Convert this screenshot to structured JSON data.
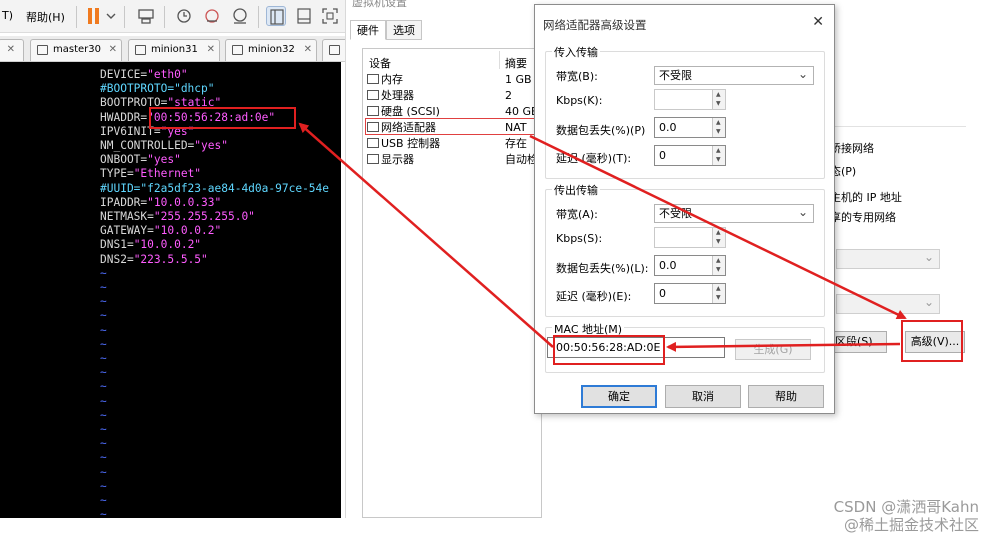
{
  "menubar": {
    "partial_item": "T)",
    "help_menu": "帮助(H)"
  },
  "tabs": [
    {
      "label": "master30"
    },
    {
      "label": "minion31"
    },
    {
      "label": "minion32"
    }
  ],
  "terminal": {
    "lines": [
      {
        "key": "DEVICE=",
        "value": "\"eth0\"",
        "comment": false
      },
      {
        "key": "#BOOTPROTO=\"dhcp\"",
        "value": "",
        "comment": true
      },
      {
        "key": "BOOTPROTO=",
        "value": "\"static\"",
        "comment": false
      },
      {
        "key": "HWADDR=",
        "value": "\"00:50:56:28:ad:0e\"",
        "comment": false
      },
      {
        "key": "IPV6INIT=",
        "value": "\"yes\"",
        "comment": false
      },
      {
        "key": "NM_CONTROLLED=",
        "value": "\"yes\"",
        "comment": false
      },
      {
        "key": "ONBOOT=",
        "value": "\"yes\"",
        "comment": false
      },
      {
        "key": "TYPE=",
        "value": "\"Ethernet\"",
        "comment": false
      },
      {
        "key": "#UUID=\"f2a5df23-ae84-4d0a-97ce-54e",
        "value": "",
        "comment": true
      },
      {
        "key": "IPADDR=",
        "value": "\"10.0.0.33\"",
        "comment": false
      },
      {
        "key": "NETMASK=",
        "value": "\"255.255.255.0\"",
        "comment": false
      },
      {
        "key": "GATEWAY=",
        "value": "\"10.0.0.2\"",
        "comment": false
      },
      {
        "key": "DNS1=",
        "value": "\"10.0.0.2\"",
        "comment": false
      },
      {
        "key": "DNS2=",
        "value": "\"223.5.5.5\"",
        "comment": false
      }
    ],
    "tilde": "~"
  },
  "settings": {
    "title": "虚拟机设置",
    "tab_hardware": "硬件",
    "tab_options": "选项",
    "col_device": "设备",
    "col_summary": "摘要",
    "devices": [
      {
        "name": "内存",
        "summary": "1 GB"
      },
      {
        "name": "处理器",
        "summary": "2"
      },
      {
        "name": "硬盘 (SCSI)",
        "summary": "40 GB"
      },
      {
        "name": "网络适配器",
        "summary": "NAT"
      },
      {
        "name": "USB 控制器",
        "summary": "存在"
      },
      {
        "name": "显示器",
        "summary": "自动检"
      }
    ],
    "right": {
      "bridged_partial": "桥接网络",
      "state_partial": "态(P)",
      "host_ip_partial": "主机的 IP 地址",
      "private_partial": "享的专用网络",
      "segments_partial": "区段(S)...",
      "advanced_button": "高级(V)..."
    }
  },
  "dialog": {
    "title": "网络适配器高级设置",
    "incoming": {
      "label": "传入传输",
      "bandwidth_label": "带宽(B):",
      "bandwidth_value": "不受限",
      "kbps_label": "Kbps(K):",
      "kbps_value": "",
      "loss_label": "数据包丢失(%)(P)",
      "loss_value": "0.0",
      "latency_label": "延迟 (毫秒)(T):",
      "latency_value": "0"
    },
    "outgoing": {
      "label": "传出传输",
      "bandwidth_label": "带宽(A):",
      "bandwidth_value": "不受限",
      "kbps_label": "Kbps(S):",
      "kbps_value": "",
      "loss_label": "数据包丢失(%)(L):",
      "loss_value": "0.0",
      "latency_label": "延迟 (毫秒)(E):",
      "latency_value": "0"
    },
    "mac": {
      "label": "MAC 地址(M)",
      "value": "00:50:56:28:AD:0E",
      "generate_button": "生成(G)"
    },
    "buttons": {
      "ok": "确定",
      "cancel": "取消",
      "help": "帮助"
    }
  },
  "watermark": {
    "line1": "CSDN @潇洒哥Kahn",
    "line2": "@稀土掘金技术社区"
  },
  "colors": {
    "annotation_red": "#e02020",
    "terminal_value": "#ff5cff",
    "terminal_comment": "#5fd7ff",
    "terminal_tilde": "#4f6fff"
  }
}
